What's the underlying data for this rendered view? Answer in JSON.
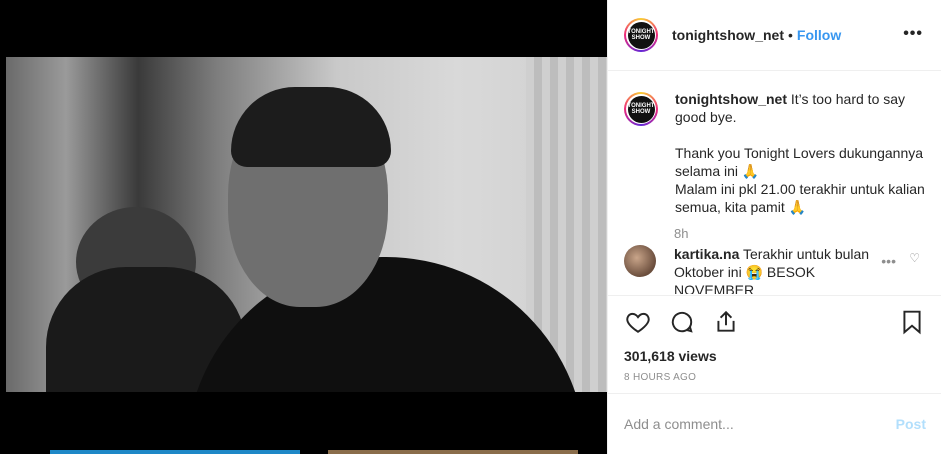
{
  "post": {
    "username": "tonightshow_net",
    "follow_label": "Follow",
    "dot": "•",
    "more_icon": "•••",
    "avatar_text_1": "TONIGHT",
    "avatar_text_2": "SHOW"
  },
  "caption": {
    "username": "tonightshow_net",
    "line1": " It’s too hard to say good bye.",
    "line2": "Thank you Tonight Lovers dukungannya selama ini 🙏",
    "line3": "Malam ini pkl 21.00 terakhir untuk kalian semua, kita pamit 🙏",
    "time": "8h"
  },
  "reply": {
    "username": "kartika.na",
    "text": " Terakhir untuk bulan Oktober ini 😭 BESOK NOVEMBER",
    "more_icon": "•••",
    "heart_icon": "♡"
  },
  "actions": {
    "icons": [
      "heart-icon",
      "comment-icon",
      "share-icon",
      "bookmark-icon"
    ],
    "views": "301,618 views",
    "ago": "8 HOURS AGO"
  },
  "comment_box": {
    "placeholder": "Add a comment...",
    "post_label": "Post"
  },
  "colors": {
    "link": "#3897f0",
    "post_disabled": "#b2dffc",
    "muted": "#8e8e8e",
    "text": "#262626"
  }
}
